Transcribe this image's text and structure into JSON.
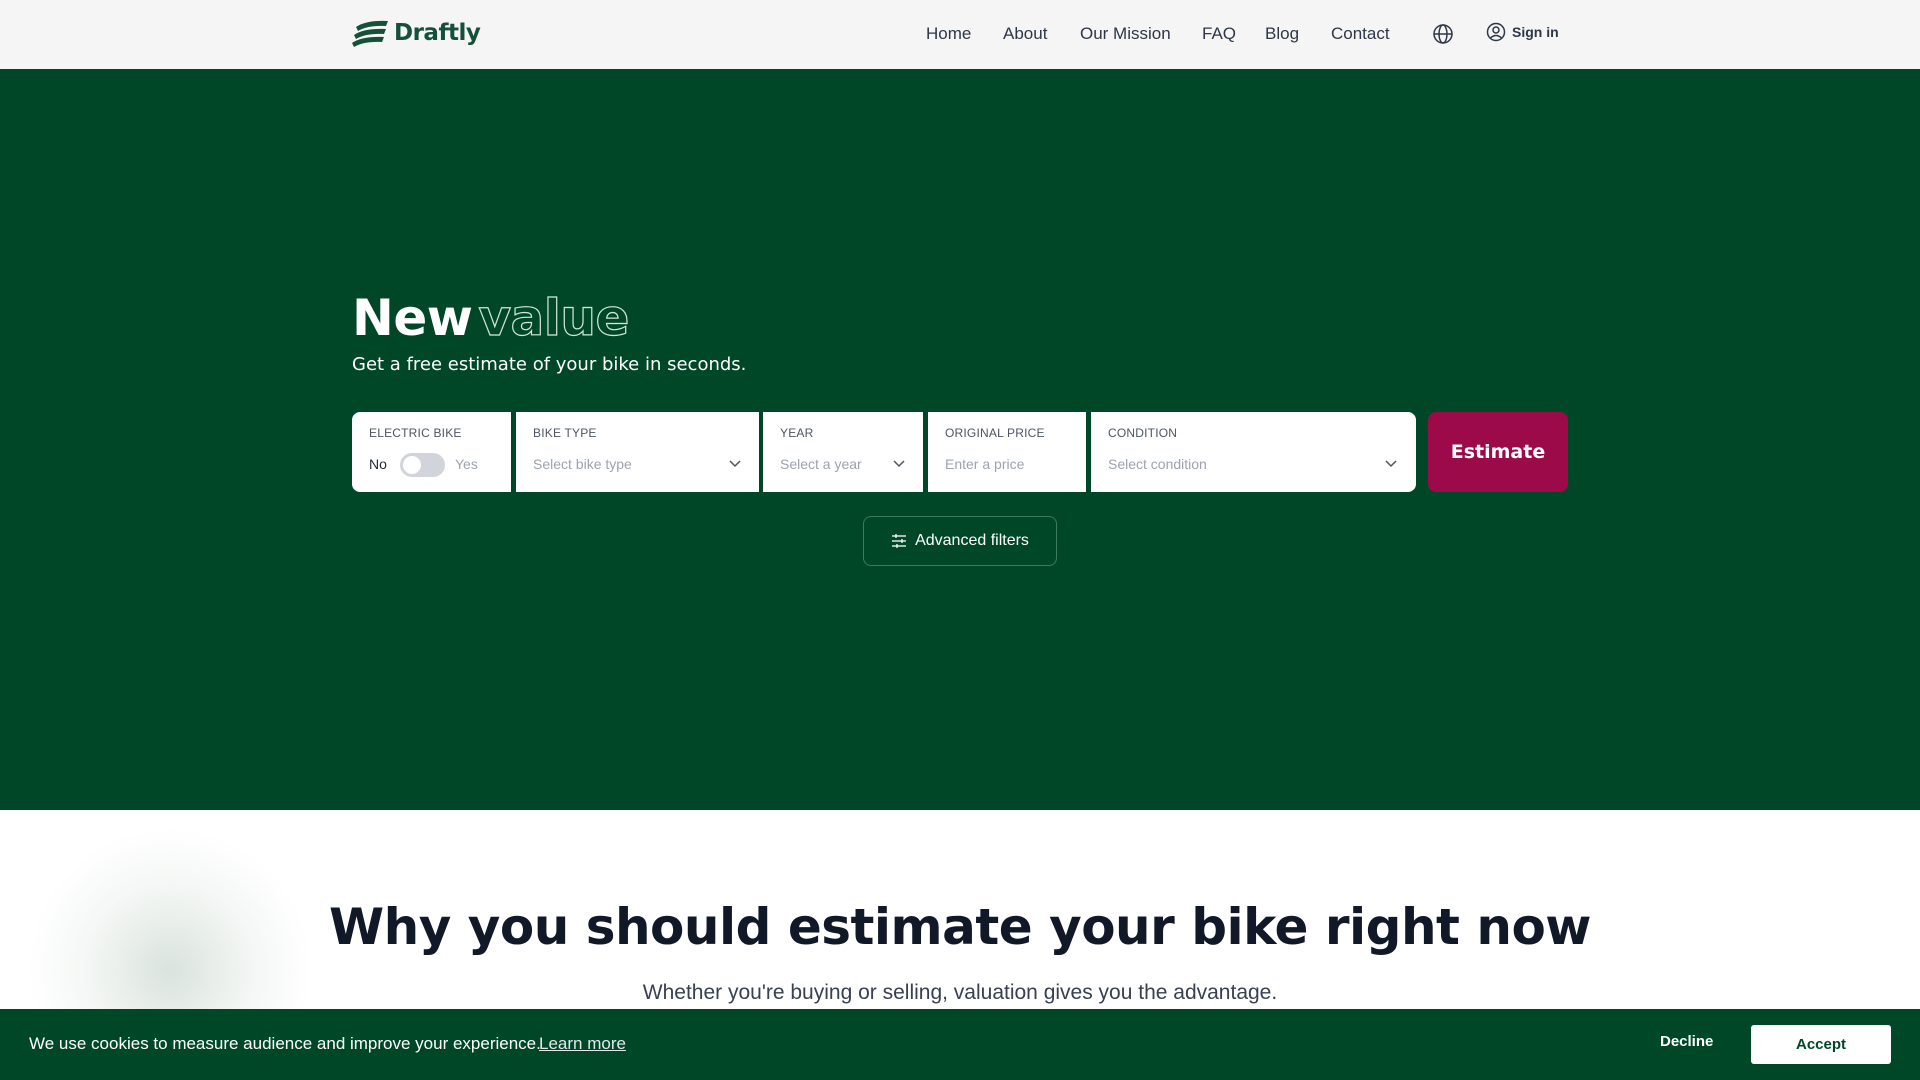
{
  "header": {
    "brand": "Draftly",
    "nav": [
      "Home",
      "About",
      "Our Mission",
      "FAQ",
      "Blog",
      "Contact"
    ],
    "language_icon": "globe-icon",
    "signin_label": "Sign in"
  },
  "hero": {
    "title_solid": "New",
    "title_outline": "value",
    "subtitle": "Get a free estimate of your bike in seconds.",
    "fields": {
      "electric": {
        "label": "ELECTRIC BIKE",
        "off_label": "No",
        "on_label": "Yes",
        "enabled": false
      },
      "bike_type": {
        "label": "BIKE TYPE",
        "placeholder": "Select bike type"
      },
      "year": {
        "label": "YEAR",
        "placeholder": "Select a year"
      },
      "price": {
        "label": "ORIGINAL PRICE",
        "placeholder": "Enter a price"
      },
      "condition": {
        "label": "CONDITION",
        "placeholder": "Select condition"
      }
    },
    "estimate_label": "Estimate",
    "advanced_label": "Advanced filters"
  },
  "why": {
    "title": "Why you should estimate your bike right now",
    "subtitle": "Whether you're buying or selling, valuation gives you the advantage."
  },
  "cookie": {
    "text": "We use cookies to measure audience and improve your experience.",
    "learn_more": "Learn more",
    "decline": "Decline",
    "accept": "Accept"
  },
  "colors": {
    "brand_green": "#004728",
    "header_bg": "#f4f5f4",
    "accent_crimson": "#9c0a4a",
    "logo_green": "#14503a"
  }
}
